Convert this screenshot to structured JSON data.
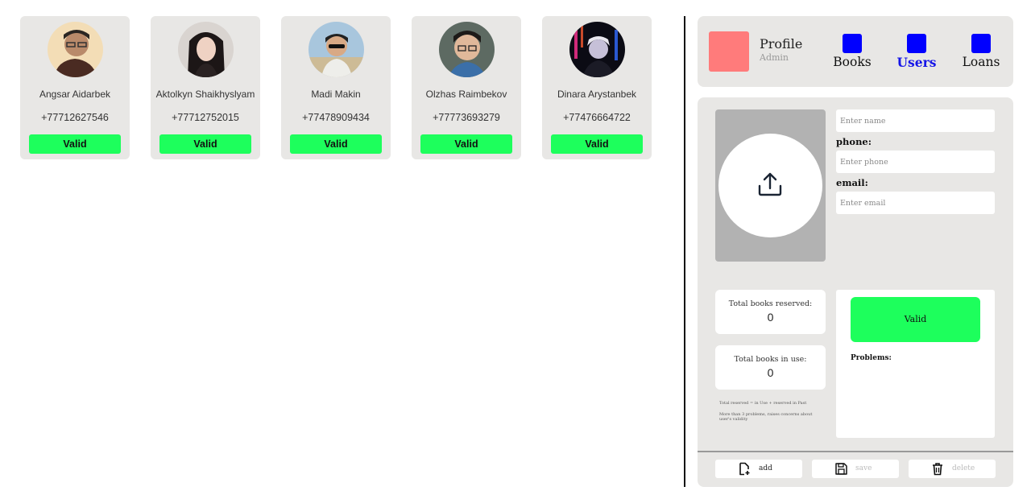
{
  "users": [
    {
      "name": "Angsar Aidarbek",
      "phone": "+77712627546",
      "status": "Valid"
    },
    {
      "name": "Aktolkyn Shaikhyslyam",
      "phone": "+77712752015",
      "status": "Valid"
    },
    {
      "name": "Madi Makin",
      "phone": "+77478909434",
      "status": "Valid"
    },
    {
      "name": "Olzhas Raimbekov",
      "phone": "+77773693279",
      "status": "Valid"
    },
    {
      "name": "Dinara Arystanbek",
      "phone": "+77476664722",
      "status": "Valid"
    }
  ],
  "header": {
    "profile_title": "Profile",
    "profile_role": "Admin",
    "nav": {
      "books": "Books",
      "users": "Users",
      "loans": "Loans"
    }
  },
  "form": {
    "name_placeholder": "Enter name",
    "phone_label": "phone:",
    "phone_placeholder": "Enter phone",
    "email_label": "email:",
    "email_placeholder": "Enter email"
  },
  "stats": {
    "reserved_label": "Total books reserved:",
    "reserved_value": "0",
    "in_use_label": "Total books in use:",
    "in_use_value": "0",
    "note1": "Total reserved = in Use + reserved in Past",
    "note2": "More than 3 problems, raises concerns about user's validity"
  },
  "status": {
    "label": "Valid",
    "problems_label": "Problems:"
  },
  "actions": {
    "add": "add",
    "save": "save",
    "delete": "delete"
  },
  "colors": {
    "valid": "#1dff5c",
    "nav_icon": "#0000ff",
    "profile": "#ff7b7b",
    "active_nav": "#1515e8"
  }
}
